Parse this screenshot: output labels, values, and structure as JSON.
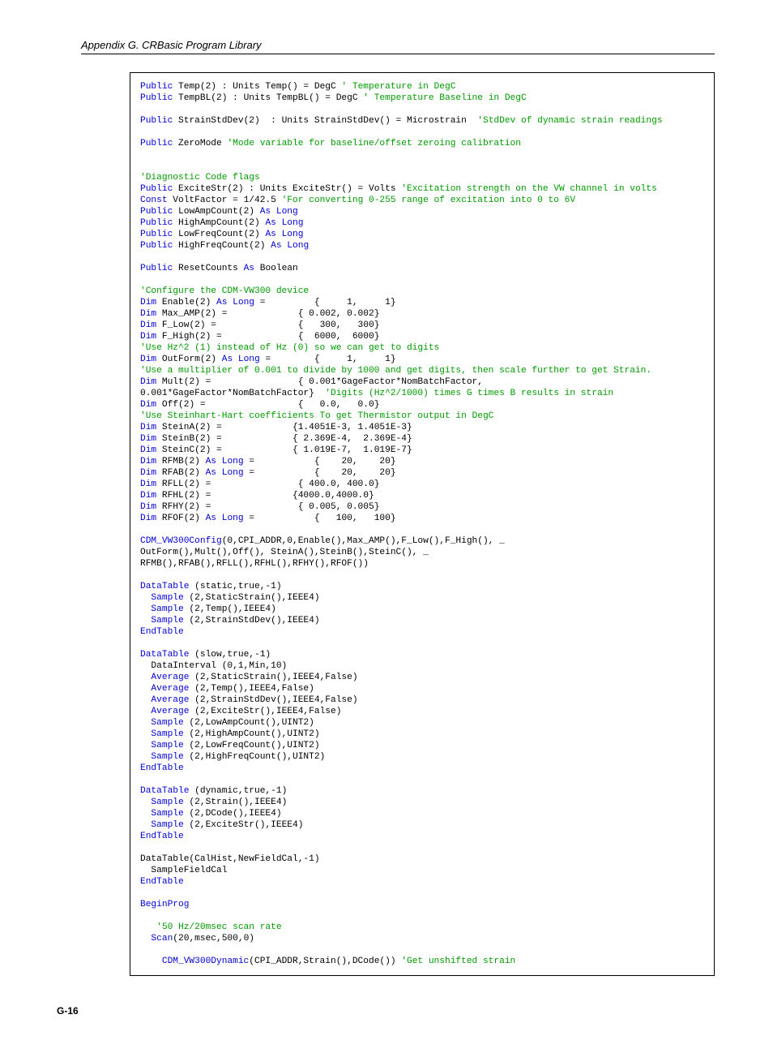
{
  "header": {
    "title": "Appendix G.  CRBasic Program Library"
  },
  "footer": {
    "pagenum": "G-16"
  },
  "code": {
    "l01a": "Public",
    "l01b": " Temp(2) : Units Temp() = DegC ",
    "l01c": "' Temperature in DegC",
    "l02a": "Public",
    "l02b": " TempBL(2) : Units TempBL() = DegC ",
    "l02c": "' Temperature Baseline in DegC",
    "l03a": "Public",
    "l03b": " StrainStdDev(2)  : Units StrainStdDev() = Microstrain  ",
    "l03c": "'StdDev of dynamic strain readings",
    "l04a": "Public",
    "l04b": " ZeroMode ",
    "l04c": "'Mode variable for baseline/offset zeroing calibration",
    "l05c": "'Diagnostic Code flags",
    "l06a": "Public",
    "l06b": " ExciteStr(2) : Units ExciteStr() = Volts ",
    "l06c": "'Excitation strength on the VW channel in volts",
    "l07a": "Const",
    "l07b": " VoltFactor = 1/42.5 ",
    "l07c": "'For converting 0-255 range of excitation into 0 to 6V",
    "l08a": "Public",
    "l08b": " LowAmpCount(2) ",
    "l08c": "As Long",
    "l09a": "Public",
    "l09b": " HighAmpCount(2) ",
    "l09c": "As Long",
    "l10a": "Public",
    "l10b": " LowFreqCount(2) ",
    "l10c": "As Long",
    "l11a": "Public",
    "l11b": " HighFreqCount(2) ",
    "l11c": "As Long",
    "l12a": "Public",
    "l12b": " ResetCounts ",
    "l12c": "As",
    "l12d": " Boolean",
    "l13c": "'Configure the CDM-VW300 device",
    "l14a": "Dim",
    "l14b": " Enable(2) ",
    "l14c": "As Long",
    "l14d": " =         {     1,     1}",
    "l15a": "Dim",
    "l15b": " Max_AMP(2) =             { 0.002, 0.002}",
    "l16a": "Dim",
    "l16b": " F_Low(2) =               {   300,   300}",
    "l17a": "Dim",
    "l17b": " F_High(2) =              {  6000,  6000}",
    "l18c": "'Use Hz^2 (1) instead of Hz (0) so we can get to digits",
    "l19a": "Dim",
    "l19b": " OutForm(2) ",
    "l19c": "As Long",
    "l19d": " =        {     1,     1}",
    "l20c": "'Use a multiplier of 0.001 to divide by 1000 and get digits, then scale further to get Strain.",
    "l21a": "Dim",
    "l21b": " Mult(2) =                { 0.001*GageFactor*NomBatchFactor,",
    "l22b": "0.001*GageFactor*NomBatchFactor}  ",
    "l22c": "'Digits (Hz^2/1000) times G times B results in strain",
    "l23a": "Dim",
    "l23b": " Off(2) =                 {   0.0,   0.0}",
    "l24c": "'Use Steinhart-Hart coefficients To get Thermistor output in DegC",
    "l25a": "Dim",
    "l25b": " SteinA(2) =             {1.4051E-3, 1.4051E-3}",
    "l26a": "Dim",
    "l26b": " SteinB(2) =             { 2.369E-4,  2.369E-4}",
    "l27a": "Dim",
    "l27b": " SteinC(2) =             { 1.019E-7,  1.019E-7}",
    "l28a": "Dim",
    "l28b": " RFMB(2) ",
    "l28c": "As Long",
    "l28d": " =           {    20,    20}",
    "l29a": "Dim",
    "l29b": " RFAB(2) ",
    "l29c": "As Long",
    "l29d": " =           {    20,    20}",
    "l30a": "Dim",
    "l30b": " RFLL(2) =                { 400.0, 400.0}",
    "l31a": "Dim",
    "l31b": " RFHL(2) =               {4000.0,4000.0}",
    "l32a": "Dim",
    "l32b": " RFHY(2) =                { 0.005, 0.005}",
    "l33a": "Dim",
    "l33b": " RFOF(2) ",
    "l33c": "As Long",
    "l33d": " =           {   100,   100}",
    "l34a": "CDM_VW300Config",
    "l34b": "(0,CPI_ADDR,0,Enable(),Max_AMP(),F_Low(),F_High(), _",
    "l35b": "OutForm(),Mult(),Off(), SteinA(),SteinB(),SteinC(), _",
    "l36b": "RFMB(),RFAB(),RFLL(),RFHL(),RFHY(),RFOF())",
    "l37a": "DataTable",
    "l37b": " (static,true,-1)",
    "l38a": "  Sample",
    "l38b": " (2,StaticStrain(),IEEE4)",
    "l39a": "  Sample",
    "l39b": " (2,Temp(),IEEE4)",
    "l40a": "  Sample",
    "l40b": " (2,StrainStdDev(),IEEE4)",
    "l41a": "EndTable",
    "l42a": "DataTable",
    "l42b": " (slow,true,-1)",
    "l43b": "  DataInterval (0,1,Min,10)",
    "l44a": "  Average",
    "l44b": " (2,StaticStrain(),IEEE4,False)",
    "l45a": "  Average",
    "l45b": " (2,Temp(),IEEE4,False)",
    "l46a": "  Average",
    "l46b": " (2,StrainStdDev(),IEEE4,False)",
    "l47a": "  Average",
    "l47b": " (2,ExciteStr(),IEEE4,False)",
    "l48a": "  Sample",
    "l48b": " (2,LowAmpCount(),UINT2)",
    "l49a": "  Sample",
    "l49b": " (2,HighAmpCount(),UINT2)",
    "l50a": "  Sample",
    "l50b": " (2,LowFreqCount(),UINT2)",
    "l51a": "  Sample",
    "l51b": " (2,HighFreqCount(),UINT2)",
    "l52a": "EndTable",
    "l53a": "DataTable",
    "l53b": " (dynamic,true,-1)",
    "l54a": "  Sample",
    "l54b": " (2,Strain(),IEEE4)",
    "l55a": "  Sample",
    "l55b": " (2,DCode(),IEEE4)",
    "l56a": "  Sample",
    "l56b": " (2,ExciteStr(),IEEE4)",
    "l57a": "EndTable",
    "l58b": "DataTable(CalHist,NewFieldCal,-1)",
    "l59b": "  SampleFieldCal",
    "l60a": "EndTable",
    "l61a": "BeginProg",
    "l62c": "   '50 Hz/20msec scan rate",
    "l63a": "  Scan",
    "l63b": "(20,msec,500,0)",
    "l64a": "    CDM_VW300Dynamic",
    "l64b": "(CPI_ADDR,Strain(),DCode()) ",
    "l64c": "'Get unshifted strain"
  }
}
